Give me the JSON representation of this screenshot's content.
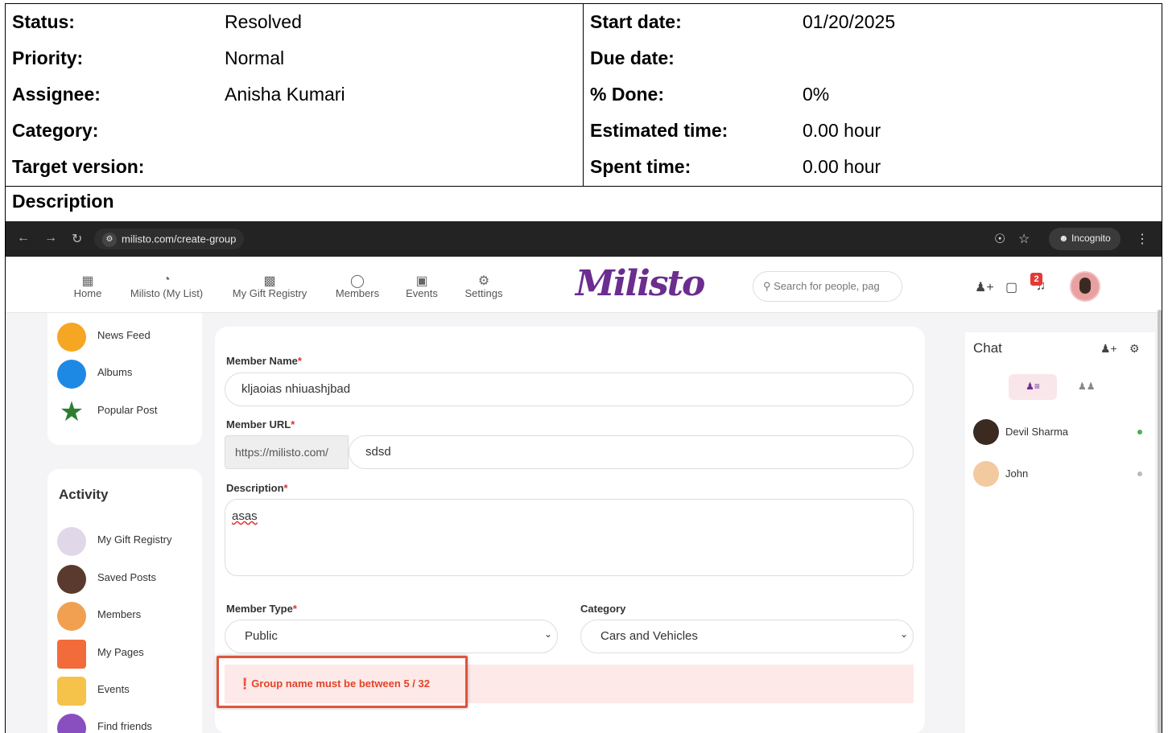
{
  "attributes": {
    "left": [
      {
        "label": "Status:",
        "value": "Resolved"
      },
      {
        "label": "Priority:",
        "value": "Normal"
      },
      {
        "label": "Assignee:",
        "value": "Anisha Kumari"
      },
      {
        "label": "Category:",
        "value": ""
      },
      {
        "label": "Target version:",
        "value": ""
      }
    ],
    "right": [
      {
        "label": "Start date:",
        "value": "01/20/2025"
      },
      {
        "label": "Due date:",
        "value": ""
      },
      {
        "label": "% Done:",
        "value": "0%"
      },
      {
        "label": "Estimated time:",
        "value": "0.00 hour"
      },
      {
        "label": "Spent time:",
        "value": "0.00 hour"
      }
    ]
  },
  "description_title": "Description",
  "browser": {
    "url": "milisto.com/create-group",
    "incognito_label": "Incognito"
  },
  "appbar": {
    "nav": [
      {
        "label": "Home",
        "icon": "grid-icon"
      },
      {
        "label": "Milisto (My List)",
        "icon": "pie-chart-icon"
      },
      {
        "label": "My Gift Registry",
        "icon": "registry-icon"
      },
      {
        "label": "Members",
        "icon": "chat-bubble-icon"
      },
      {
        "label": "Events",
        "icon": "calendar-icon"
      },
      {
        "label": "Settings",
        "icon": "gear-icon"
      }
    ],
    "logo": "Milisto",
    "search_placeholder": "Search for people, pag",
    "notification_count": "2"
  },
  "sidebar": {
    "top_items": [
      {
        "label": "News Feed",
        "icon": "megaphone-icon",
        "color": "#f5a623"
      },
      {
        "label": "Albums",
        "icon": "albums-icon",
        "color": "#1e88e5"
      },
      {
        "label": "Popular Post",
        "icon": "star-icon",
        "color": "#2e7d32"
      }
    ],
    "activity_title": "Activity",
    "activity_items": [
      {
        "label": "My Gift Registry",
        "icon": "gift-registry-icon",
        "color": "#e0d7e8"
      },
      {
        "label": "Saved Posts",
        "icon": "saved-posts-icon",
        "color": "#5a3a2e"
      },
      {
        "label": "Members",
        "icon": "members-icon",
        "color": "#f0a050"
      },
      {
        "label": "My Pages",
        "icon": "pages-icon",
        "color": "#f26b3a"
      },
      {
        "label": "Events",
        "icon": "events-icon",
        "color": "#f5c24a"
      },
      {
        "label": "Find friends",
        "icon": "find-friends-icon",
        "color": "#8a4fbf"
      }
    ]
  },
  "form": {
    "member_name_label": "Member Name",
    "member_name_value": "kljaoias  nhiuashjbad",
    "member_url_label": "Member URL",
    "url_prefix": "https://milisto.com/",
    "member_url_value": "sdsd",
    "description_label": "Description",
    "description_value": "asas",
    "member_type_label": "Member Type",
    "member_type_value": "Public",
    "category_label": "Category",
    "category_value": "Cars and Vehicles",
    "required_mark": "*",
    "error_message": "Group name must be between 5 / 32"
  },
  "chat": {
    "title": "Chat",
    "contacts": [
      {
        "name": "Devil Sharma",
        "status": "online",
        "status_color": "#4caf50"
      },
      {
        "name": "John",
        "status": "offline",
        "status_color": "#bbbbbb"
      }
    ]
  }
}
